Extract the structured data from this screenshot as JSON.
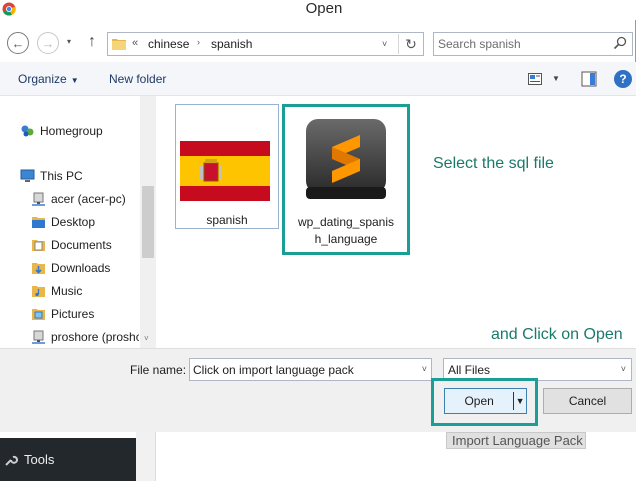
{
  "window": {
    "title": "Open"
  },
  "navigation": {
    "back_symbol": "←",
    "forward_symbol": "→",
    "up_symbol": "↑",
    "history_caret": "▾",
    "refresh_symbol": "↻"
  },
  "address_bar": {
    "prefix": "«",
    "crumbs": [
      "chinese",
      "spanish"
    ],
    "separator": "›",
    "dropdown_caret": "˅"
  },
  "search": {
    "placeholder": "Search spanish"
  },
  "toolbar": {
    "organize_label": "Organize",
    "organize_caret": "▼",
    "new_folder_label": "New folder",
    "view_caret": "▼",
    "help_label": "?"
  },
  "nav_pane": {
    "items": [
      {
        "label": "Homegroup",
        "icon": "homegroup-icon"
      },
      {
        "label": "This PC",
        "icon": "computer-icon"
      },
      {
        "label": "acer (acer-pc)",
        "icon": "network-drive-icon"
      },
      {
        "label": "Desktop",
        "icon": "folder-icon"
      },
      {
        "label": "Documents",
        "icon": "documents-icon"
      },
      {
        "label": "Downloads",
        "icon": "downloads-icon"
      },
      {
        "label": "Music",
        "icon": "music-icon"
      },
      {
        "label": "Pictures",
        "icon": "pictures-icon"
      },
      {
        "label": "proshore (proshc",
        "icon": "network-drive-icon"
      }
    ],
    "scroll_down": "˅"
  },
  "files": [
    {
      "name": "spanish",
      "icon": "spain-flag-folder-icon"
    },
    {
      "name": "wp_dating_spanis\nh_language",
      "icon": "sublime-text-icon"
    }
  ],
  "annotations": {
    "select": "Select the sql file",
    "click": "and Click on Open"
  },
  "bottom": {
    "file_name_label": "File name:",
    "file_name_value": "Click on import language pack",
    "file_name_caret": "˅",
    "file_type_value": "All Files",
    "file_type_caret": "˅",
    "open_label": "Open",
    "open_caret": "▼",
    "cancel_label": "Cancel"
  },
  "background_app": {
    "tools_label": "Tools",
    "import_label": "Import Language Pack"
  },
  "colors": {
    "highlight": "#1a9e96",
    "annotation_text": "#1a7a6a",
    "toolbar_bg": "#f4f6f9",
    "bottom_bg": "#f0f0f0"
  }
}
